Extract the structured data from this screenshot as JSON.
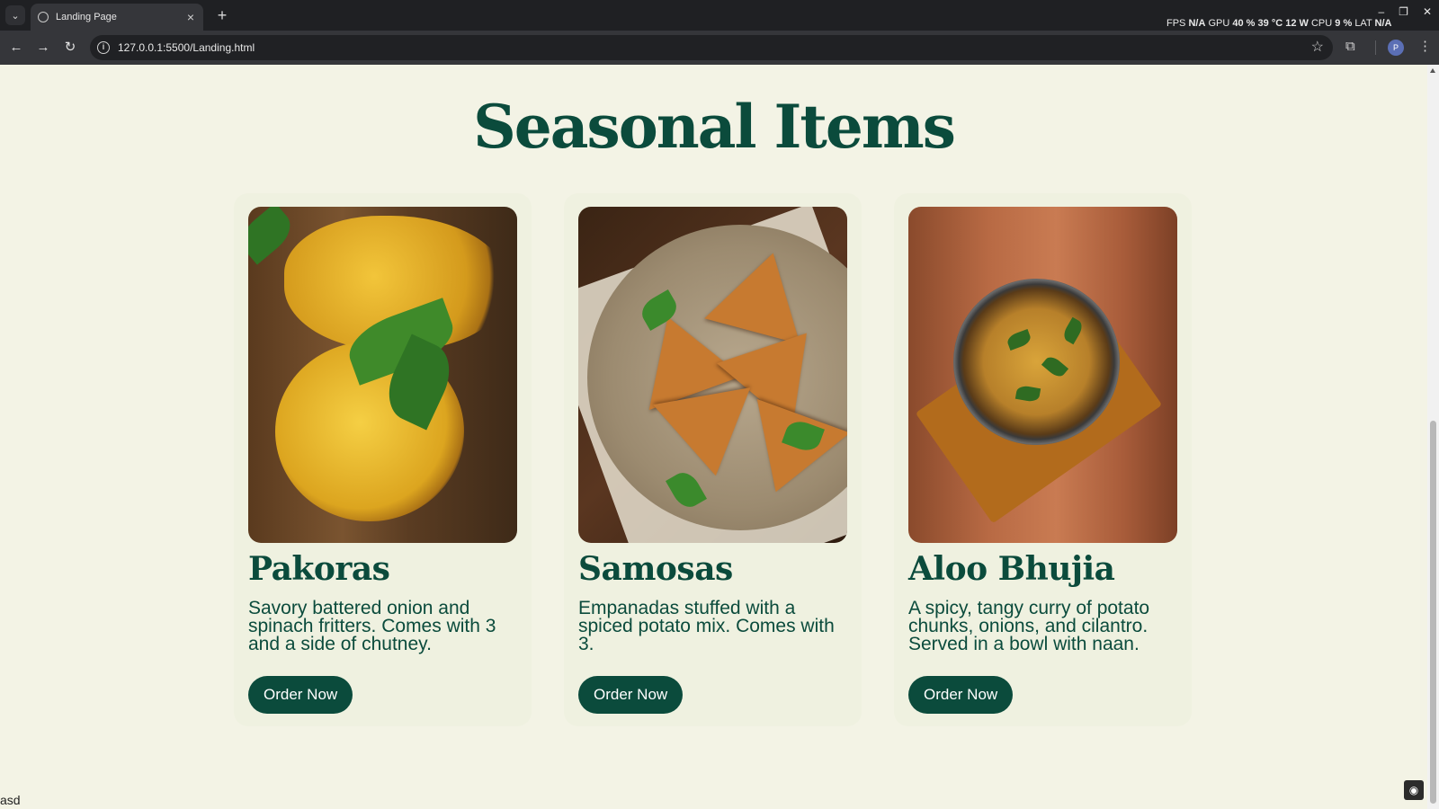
{
  "browser": {
    "tab_title": "Landing Page",
    "new_tab": "+",
    "url": "127.0.0.1:5500/Landing.html",
    "osd": {
      "fps_label": "FPS",
      "fps_value": "N/A",
      "gpu_label": "GPU",
      "gpu_value": "40 %",
      "gpu_temp": "39 °C",
      "gpu_power": "12 W",
      "cpu_label": "CPU",
      "cpu_value": "9 %",
      "lat_label": "LAT",
      "lat_value": "N/A"
    },
    "profile_initial": "P"
  },
  "page": {
    "title": "Seasonal Items",
    "items": [
      {
        "name": "Pakoras",
        "description": "Savory battered onion and spinach fritters. Comes with 3 and a side of chutney.",
        "button": "Order Now",
        "image_icon": "pakoras-photo"
      },
      {
        "name": "Samosas",
        "description": "Empanadas stuffed with a spiced potato mix. Comes with 3.",
        "button": "Order Now",
        "image_icon": "samosas-photo"
      },
      {
        "name": "Aloo Bhujia",
        "description": "A spicy, tangy curry of potato chunks, onions, and cilantro. Served in a bowl with naan.",
        "button": "Order Now",
        "image_icon": "aloo-bhujia-photo"
      }
    ],
    "corner_text": "asd"
  },
  "colors": {
    "brand_green": "#0b4b3c",
    "page_background": "#f3f3e5",
    "card_background": "#eff1e0"
  }
}
